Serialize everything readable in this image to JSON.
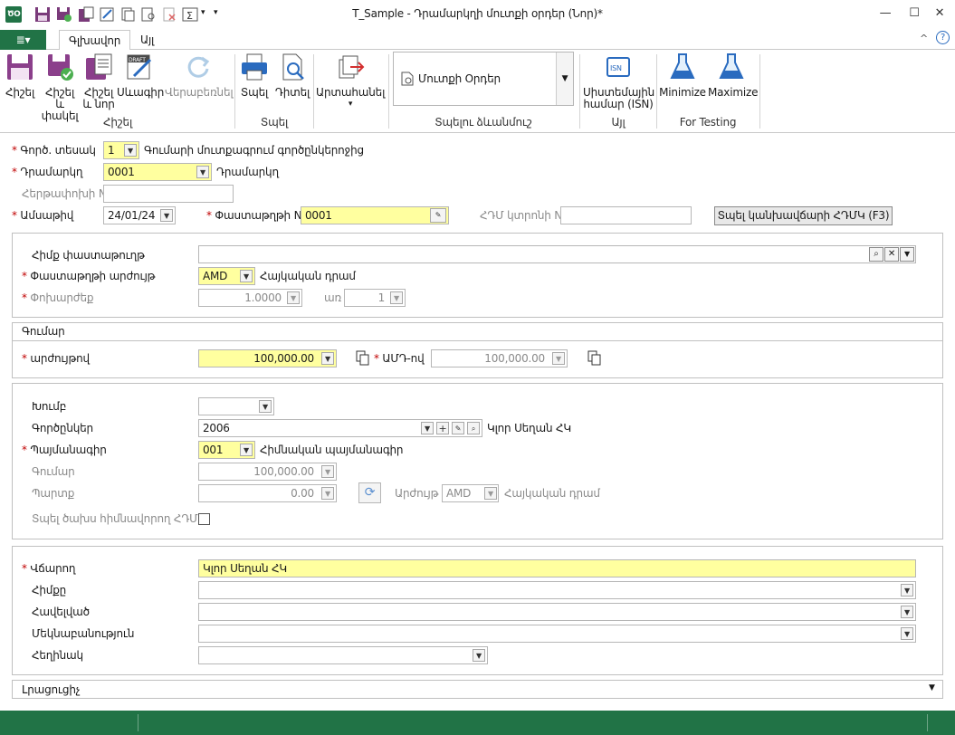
{
  "window": {
    "title": "T_Sample - Դրամարկղի մուտքի օրդեր (Նոր)*",
    "minimize": "—",
    "maximize": "☐",
    "close": "✕"
  },
  "tabs": {
    "file_icon": "≣▾",
    "main": "Գլխավոր",
    "other": "Այլ",
    "help_icon": "?",
    "collapse_icon": "^"
  },
  "ribbon": {
    "save": "Հիշել",
    "save_close": "Հիշել և փակել",
    "save_new": "Հիշել և նոր",
    "draft": "Սևագիր",
    "draft_badge": "DRAFT",
    "restore": "Վերաբեռնել",
    "print": "Տպել",
    "view": "Դիտել",
    "export": "Արտահանել",
    "gallery_item": "Մուտքի Օրդեր",
    "isn": "Սիստեմային համար (ISN)",
    "isn_badge": "ISN",
    "minimize": "Minimize",
    "maximize": "Maximize",
    "groups": {
      "save": "Հիշել",
      "print": "Տպել",
      "print_forms": "Տպելու ձևանմուշ",
      "other": "Այլ",
      "testing": "For Testing"
    }
  },
  "header": {
    "op_type_label": "Գործ. տեսակ",
    "op_type_value": "1",
    "op_type_desc": "Գումարի մուտքագրում գործընկերոջից",
    "cashbox_label": "Դրամարկղ",
    "cashbox_value": "0001",
    "cashbox_desc": "Դրամարկղ",
    "tax_label": "Հերթափոխի N",
    "date_label": "Ամսաթիվ",
    "date_value": "24/01/24",
    "doc_label": "Փաստաթղթի N",
    "doc_value": "0001",
    "ecr_label": "ՀԴՄ կտրոնի N",
    "print_button": "Տպել կանխավճարի ՀԴՄԿ (F3)"
  },
  "currency_panel": {
    "base_doc_label": "Հիմք փաստաթուղթ",
    "currency_label": "Փաստաթղթի արժույթ",
    "currency_value": "AMD",
    "currency_desc": "Հայկական դրամ",
    "rate_label": "Փոխարժեք",
    "rate_value": "1.0000",
    "per_label": "առ",
    "per_value": "1"
  },
  "amount_panel": {
    "title": "Գումար",
    "value_label": "արժույթով",
    "value": "100,000.00",
    "amd_label": "ԱՄԴ-ով",
    "amd_value": "100,000.00"
  },
  "partner_panel": {
    "group_label": "Խումբ",
    "partner_label": "Գործընկեր",
    "partner_value": "2006",
    "partner_desc": "Կլոր Սեղան ՀԿ",
    "contract_label": "Պայմանագիր",
    "contract_value": "001",
    "contract_desc": "Հիմնական պայմանագիր",
    "sum_label": "Գումար",
    "sum_value": "100,000.00",
    "debt_label": "Պարտք",
    "debt_value": "0.00",
    "cur_label": "Արժույթ",
    "cur_value": "AMD",
    "cur_desc": "Հայկական դրամ",
    "print_flag_label": "Տպել ծախս հիմնավորող ՀԴՄԿ"
  },
  "payer_panel": {
    "payer_label": "Վճարող",
    "payer_value": "Կլոր Սեղան ՀԿ",
    "basis_label": "Հիմքը",
    "attach_label": "Հավելված",
    "comment_label": "Մեկնաբանություն",
    "author_label": "Հեղինակ"
  },
  "extra_panel": {
    "title": "Լրացուցիչ"
  },
  "colors": {
    "brand": "#217346",
    "required": "#c00000",
    "highlight": "#ffff9f"
  }
}
